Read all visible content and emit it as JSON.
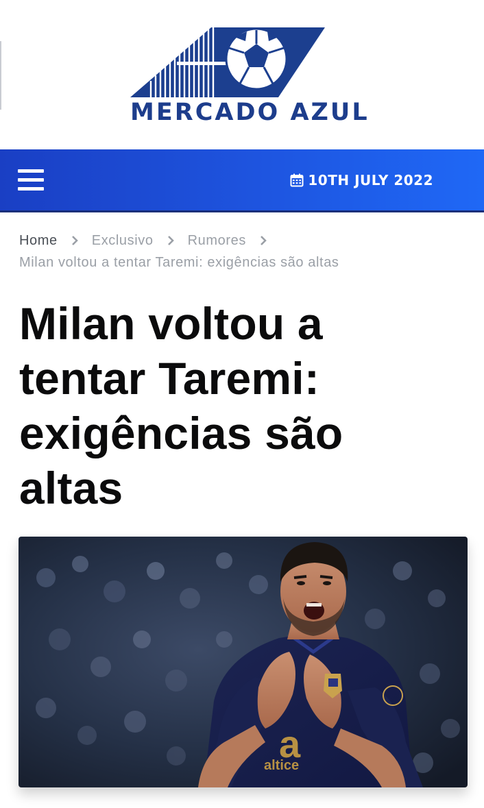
{
  "site": {
    "logo_text": "MERCADO AZUL",
    "brand_color": "#1d3d8c",
    "logo_icon": "soccer-ball-logo"
  },
  "navbar": {
    "menu_icon": "hamburger-menu-icon",
    "date_icon": "calendar-icon",
    "date": "10TH JULY 2022",
    "gradient_colors": [
      "#1a3fc4",
      "#1f68f6"
    ]
  },
  "breadcrumb": {
    "items": [
      "Home",
      "Exclusivo",
      "Rumores"
    ],
    "separator_icon": "chevron-right-icon",
    "current": "Milan voltou a tentar Taremi: exigências são altas"
  },
  "article": {
    "title": "Milan voltou a tentar Taremi: exigências são altas",
    "image_alt": "",
    "image_subject": "player in dark blue jersey shouting and clapping in stadium",
    "jersey_sponsor": "altice"
  }
}
